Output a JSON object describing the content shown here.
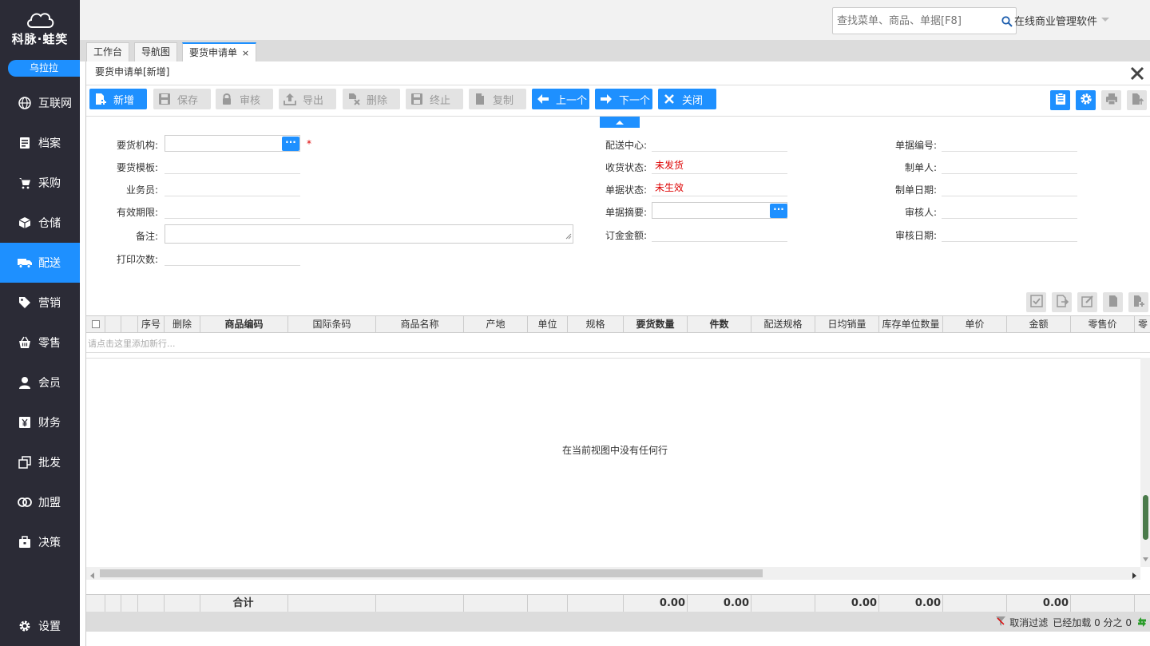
{
  "sidebar": {
    "logo_text": "科脉·蛙笑",
    "user": "乌拉拉",
    "items": [
      {
        "label": "互联网",
        "icon": "globe-icon"
      },
      {
        "label": "档案",
        "icon": "file-icon"
      },
      {
        "label": "采购",
        "icon": "cart-icon"
      },
      {
        "label": "仓储",
        "icon": "box-icon"
      },
      {
        "label": "配送",
        "icon": "truck-icon"
      },
      {
        "label": "营销",
        "icon": "tag-icon"
      },
      {
        "label": "零售",
        "icon": "basket-icon"
      },
      {
        "label": "会员",
        "icon": "user-icon"
      },
      {
        "label": "财务",
        "icon": "yen-icon"
      },
      {
        "label": "批发",
        "icon": "copy-icon"
      },
      {
        "label": "加盟",
        "icon": "rings-icon"
      },
      {
        "label": "决策",
        "icon": "briefcase-icon"
      }
    ],
    "active_index": 4,
    "settings_label": "设置"
  },
  "topbar": {
    "search_placeholder": "查找菜单、商品、单据[F8]",
    "company": "在线商业管理软件"
  },
  "tabs": [
    {
      "label": "工作台"
    },
    {
      "label": "导航图"
    },
    {
      "label": "要货申请单"
    }
  ],
  "panel": {
    "title": "要货申请单[新增]"
  },
  "toolbar": {
    "new": "新增",
    "save": "保存",
    "audit": "审核",
    "export": "导出",
    "delete": "删除",
    "stop": "终止",
    "copy": "复制",
    "prev": "上一个",
    "next": "下一个",
    "close": "关闭"
  },
  "form": {
    "org_label": "要货机构:",
    "template_label": "要货模板:",
    "salesman_label": "业务员:",
    "valid_label": "有效期限:",
    "remark_label": "备注:",
    "print_label": "打印次数:",
    "center_label": "配送中心:",
    "receive_label": "收货状态:",
    "receive_value": "未发货",
    "doc_state_label": "单据状态:",
    "doc_state_value": "未生效",
    "summary_label": "单据摘要:",
    "deposit_label": "订金金额:",
    "doc_no_label": "单据编号:",
    "maker_label": "制单人:",
    "make_date_label": "制单日期:",
    "auditor_label": "审核人:",
    "audit_date_label": "审核日期:",
    "required_mark": "*"
  },
  "grid": {
    "columns": [
      "序号",
      "删除",
      "商品编码",
      "国际条码",
      "商品名称",
      "产地",
      "单位",
      "规格",
      "要货数量",
      "件数",
      "配送规格",
      "日均销量",
      "库存单位数量",
      "单价",
      "金额",
      "零售价",
      "零"
    ],
    "add_row_hint": "请点击这里添加新行...",
    "empty_message": "在当前视图中没有任何行",
    "sum_label": "合计",
    "sums": {
      "qty": "0.00",
      "pieces": "0.00",
      "daily": "0.00",
      "stock": "0.00",
      "amount": "0.00"
    }
  },
  "status": {
    "filter": "取消过滤",
    "loaded": "已经加载 0 分之 0"
  }
}
